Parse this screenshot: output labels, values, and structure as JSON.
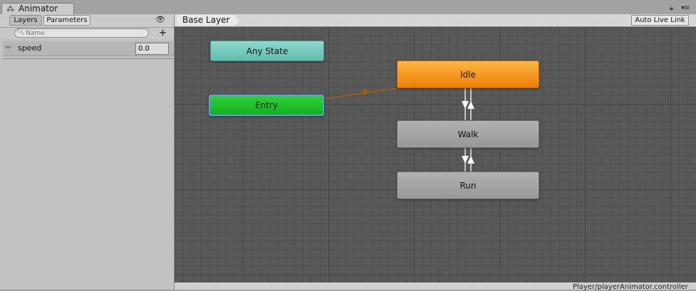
{
  "window": {
    "title": "Animator",
    "icon": "animator-icon"
  },
  "left_panel": {
    "tabs": [
      "Layers",
      "Parameters"
    ],
    "search": {
      "placeholder": "Name",
      "value": ""
    },
    "parameters": [
      {
        "name": "speed",
        "value": "0.0"
      }
    ]
  },
  "graph": {
    "breadcrumb": "Base Layer",
    "live_link_label": "Auto Live Link",
    "states": {
      "any_state": "Any State",
      "entry": "Entry",
      "idle": "Idle",
      "walk": "Walk",
      "run": "Run"
    },
    "status_path": "Player/playerAnimator.controller"
  },
  "colors": {
    "any_state": "#6fc8b8",
    "entry": "#1cc02a",
    "default_state": "#f09010",
    "normal_state": "#a3a3a3",
    "entry_transition": "#a06010",
    "transition": "#ffffff",
    "graph_background": "#585858"
  },
  "icons": [
    "animator-icon",
    "lock-icon",
    "menu-icon",
    "eye-icon",
    "search-icon",
    "add-icon",
    "drag-handle-icon"
  ]
}
